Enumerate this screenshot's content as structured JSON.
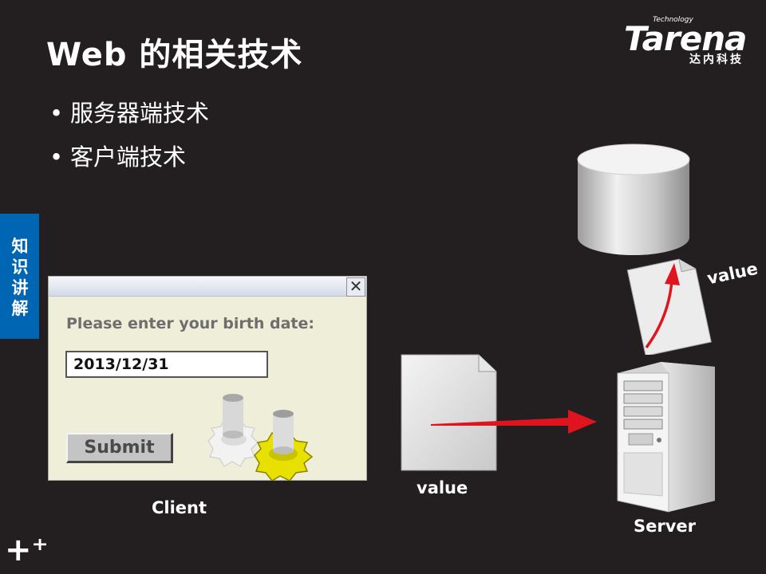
{
  "slide": {
    "title": "Web 的相关技术",
    "bullets": [
      "服务器端技术",
      "客户端技术"
    ],
    "side_tab": "知识讲解"
  },
  "logo": {
    "technology": "Technology",
    "brand": "Tarena",
    "cn": "达内科技"
  },
  "dialog": {
    "prompt": "Please enter your birth date:",
    "date_value": "2013/12/31",
    "submit_label": "Submit",
    "close_glyph": "✕"
  },
  "captions": {
    "client": "Client",
    "value_doc": "value",
    "value_db": "value",
    "server": "Server"
  },
  "footer": {
    "plus_glyph": "+⁺"
  },
  "colors": {
    "background": "#231f20",
    "side_tab": "#0066b3",
    "arrow": "#e0141e",
    "gear_yellow": "#e8e000"
  }
}
